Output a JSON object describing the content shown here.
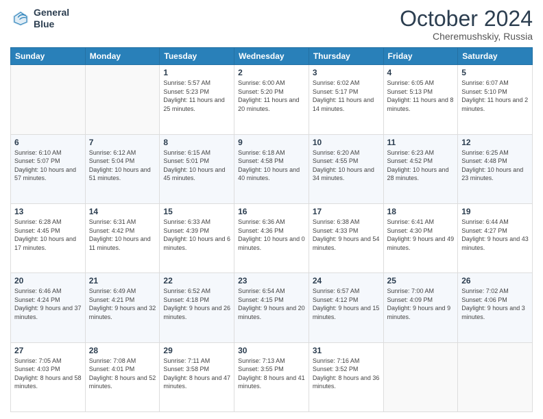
{
  "logo": {
    "line1": "General",
    "line2": "Blue"
  },
  "title": "October 2024",
  "location": "Cheremushskiy, Russia",
  "days_of_week": [
    "Sunday",
    "Monday",
    "Tuesday",
    "Wednesday",
    "Thursday",
    "Friday",
    "Saturday"
  ],
  "weeks": [
    [
      {
        "num": "",
        "sunrise": "",
        "sunset": "",
        "daylight": "",
        "empty": true
      },
      {
        "num": "",
        "sunrise": "",
        "sunset": "",
        "daylight": "",
        "empty": true
      },
      {
        "num": "1",
        "sunrise": "Sunrise: 5:57 AM",
        "sunset": "Sunset: 5:23 PM",
        "daylight": "Daylight: 11 hours and 25 minutes.",
        "empty": false
      },
      {
        "num": "2",
        "sunrise": "Sunrise: 6:00 AM",
        "sunset": "Sunset: 5:20 PM",
        "daylight": "Daylight: 11 hours and 20 minutes.",
        "empty": false
      },
      {
        "num": "3",
        "sunrise": "Sunrise: 6:02 AM",
        "sunset": "Sunset: 5:17 PM",
        "daylight": "Daylight: 11 hours and 14 minutes.",
        "empty": false
      },
      {
        "num": "4",
        "sunrise": "Sunrise: 6:05 AM",
        "sunset": "Sunset: 5:13 PM",
        "daylight": "Daylight: 11 hours and 8 minutes.",
        "empty": false
      },
      {
        "num": "5",
        "sunrise": "Sunrise: 6:07 AM",
        "sunset": "Sunset: 5:10 PM",
        "daylight": "Daylight: 11 hours and 2 minutes.",
        "empty": false
      }
    ],
    [
      {
        "num": "6",
        "sunrise": "Sunrise: 6:10 AM",
        "sunset": "Sunset: 5:07 PM",
        "daylight": "Daylight: 10 hours and 57 minutes.",
        "empty": false
      },
      {
        "num": "7",
        "sunrise": "Sunrise: 6:12 AM",
        "sunset": "Sunset: 5:04 PM",
        "daylight": "Daylight: 10 hours and 51 minutes.",
        "empty": false
      },
      {
        "num": "8",
        "sunrise": "Sunrise: 6:15 AM",
        "sunset": "Sunset: 5:01 PM",
        "daylight": "Daylight: 10 hours and 45 minutes.",
        "empty": false
      },
      {
        "num": "9",
        "sunrise": "Sunrise: 6:18 AM",
        "sunset": "Sunset: 4:58 PM",
        "daylight": "Daylight: 10 hours and 40 minutes.",
        "empty": false
      },
      {
        "num": "10",
        "sunrise": "Sunrise: 6:20 AM",
        "sunset": "Sunset: 4:55 PM",
        "daylight": "Daylight: 10 hours and 34 minutes.",
        "empty": false
      },
      {
        "num": "11",
        "sunrise": "Sunrise: 6:23 AM",
        "sunset": "Sunset: 4:52 PM",
        "daylight": "Daylight: 10 hours and 28 minutes.",
        "empty": false
      },
      {
        "num": "12",
        "sunrise": "Sunrise: 6:25 AM",
        "sunset": "Sunset: 4:48 PM",
        "daylight": "Daylight: 10 hours and 23 minutes.",
        "empty": false
      }
    ],
    [
      {
        "num": "13",
        "sunrise": "Sunrise: 6:28 AM",
        "sunset": "Sunset: 4:45 PM",
        "daylight": "Daylight: 10 hours and 17 minutes.",
        "empty": false
      },
      {
        "num": "14",
        "sunrise": "Sunrise: 6:31 AM",
        "sunset": "Sunset: 4:42 PM",
        "daylight": "Daylight: 10 hours and 11 minutes.",
        "empty": false
      },
      {
        "num": "15",
        "sunrise": "Sunrise: 6:33 AM",
        "sunset": "Sunset: 4:39 PM",
        "daylight": "Daylight: 10 hours and 6 minutes.",
        "empty": false
      },
      {
        "num": "16",
        "sunrise": "Sunrise: 6:36 AM",
        "sunset": "Sunset: 4:36 PM",
        "daylight": "Daylight: 10 hours and 0 minutes.",
        "empty": false
      },
      {
        "num": "17",
        "sunrise": "Sunrise: 6:38 AM",
        "sunset": "Sunset: 4:33 PM",
        "daylight": "Daylight: 9 hours and 54 minutes.",
        "empty": false
      },
      {
        "num": "18",
        "sunrise": "Sunrise: 6:41 AM",
        "sunset": "Sunset: 4:30 PM",
        "daylight": "Daylight: 9 hours and 49 minutes.",
        "empty": false
      },
      {
        "num": "19",
        "sunrise": "Sunrise: 6:44 AM",
        "sunset": "Sunset: 4:27 PM",
        "daylight": "Daylight: 9 hours and 43 minutes.",
        "empty": false
      }
    ],
    [
      {
        "num": "20",
        "sunrise": "Sunrise: 6:46 AM",
        "sunset": "Sunset: 4:24 PM",
        "daylight": "Daylight: 9 hours and 37 minutes.",
        "empty": false
      },
      {
        "num": "21",
        "sunrise": "Sunrise: 6:49 AM",
        "sunset": "Sunset: 4:21 PM",
        "daylight": "Daylight: 9 hours and 32 minutes.",
        "empty": false
      },
      {
        "num": "22",
        "sunrise": "Sunrise: 6:52 AM",
        "sunset": "Sunset: 4:18 PM",
        "daylight": "Daylight: 9 hours and 26 minutes.",
        "empty": false
      },
      {
        "num": "23",
        "sunrise": "Sunrise: 6:54 AM",
        "sunset": "Sunset: 4:15 PM",
        "daylight": "Daylight: 9 hours and 20 minutes.",
        "empty": false
      },
      {
        "num": "24",
        "sunrise": "Sunrise: 6:57 AM",
        "sunset": "Sunset: 4:12 PM",
        "daylight": "Daylight: 9 hours and 15 minutes.",
        "empty": false
      },
      {
        "num": "25",
        "sunrise": "Sunrise: 7:00 AM",
        "sunset": "Sunset: 4:09 PM",
        "daylight": "Daylight: 9 hours and 9 minutes.",
        "empty": false
      },
      {
        "num": "26",
        "sunrise": "Sunrise: 7:02 AM",
        "sunset": "Sunset: 4:06 PM",
        "daylight": "Daylight: 9 hours and 3 minutes.",
        "empty": false
      }
    ],
    [
      {
        "num": "27",
        "sunrise": "Sunrise: 7:05 AM",
        "sunset": "Sunset: 4:03 PM",
        "daylight": "Daylight: 8 hours and 58 minutes.",
        "empty": false
      },
      {
        "num": "28",
        "sunrise": "Sunrise: 7:08 AM",
        "sunset": "Sunset: 4:01 PM",
        "daylight": "Daylight: 8 hours and 52 minutes.",
        "empty": false
      },
      {
        "num": "29",
        "sunrise": "Sunrise: 7:11 AM",
        "sunset": "Sunset: 3:58 PM",
        "daylight": "Daylight: 8 hours and 47 minutes.",
        "empty": false
      },
      {
        "num": "30",
        "sunrise": "Sunrise: 7:13 AM",
        "sunset": "Sunset: 3:55 PM",
        "daylight": "Daylight: 8 hours and 41 minutes.",
        "empty": false
      },
      {
        "num": "31",
        "sunrise": "Sunrise: 7:16 AM",
        "sunset": "Sunset: 3:52 PM",
        "daylight": "Daylight: 8 hours and 36 minutes.",
        "empty": false
      },
      {
        "num": "",
        "sunrise": "",
        "sunset": "",
        "daylight": "",
        "empty": true
      },
      {
        "num": "",
        "sunrise": "",
        "sunset": "",
        "daylight": "",
        "empty": true
      }
    ]
  ]
}
